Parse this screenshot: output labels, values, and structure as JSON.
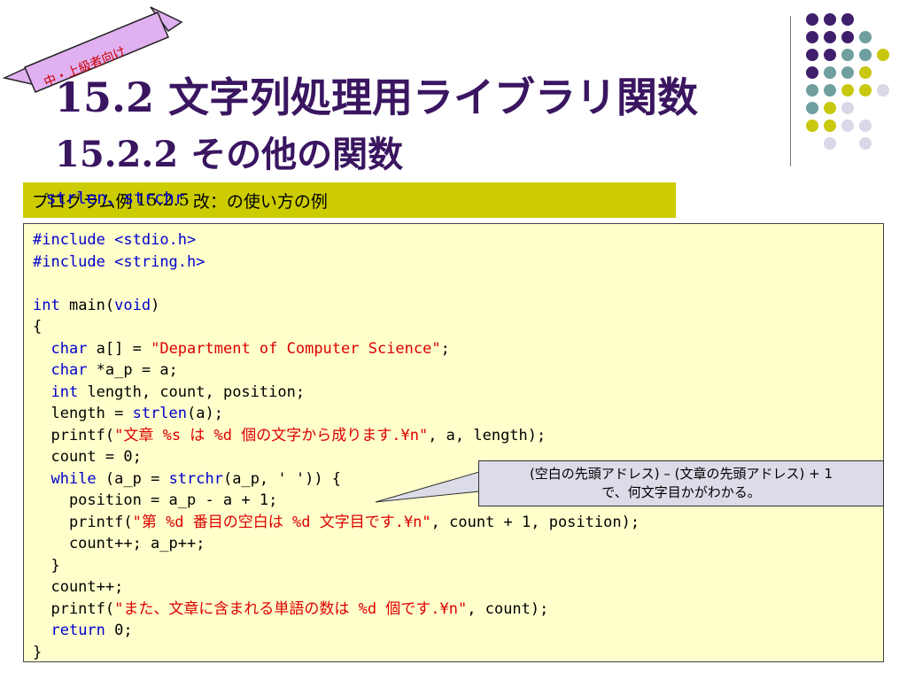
{
  "ribbon_label": "中・上級者向け",
  "title": "15.2 文字列処理用ライブラリ関数",
  "subtitle": "15.2.2 その他の関数",
  "caption": {
    "prefix": "プログラム例",
    "number": "15.2.5",
    "suffix": "改：",
    "functions": "strlen、strchr",
    "tail": "の使い方の例"
  },
  "code_lines": [
    "#include <stdio.h>",
    "#include <string.h>",
    "",
    "int main(void)",
    "{",
    "  char a[] = \"Department of Computer Science\";",
    "  char *a_p = a;",
    "  int length, count, position;",
    "  length = strlen(a);",
    "  printf(\"文章 %s は %d 個の文字から成ります.¥n\", a, length);",
    "  count = 0;",
    "  while (a_p = strchr(a_p, ' ')) {",
    "    position = a_p - a + 1;",
    "    printf(\"第 %d 番目の空白は %d 文字目です.¥n\", count + 1, position);",
    "    count++; a_p++;",
    "  }",
    "  count++;",
    "  printf(\"また、文章に含まれる単語の数は %d 個です.¥n\", count);",
    "  return 0;",
    "}"
  ],
  "callout": {
    "line1": "(空白の先頭アドレス) – (文章の先頭アドレス) + 1",
    "line2": "で、何文字目かがわかる。"
  },
  "colors": {
    "title": "#3a1560",
    "caption_bg": "#cccc00",
    "code_bg": "#ffffcc",
    "keyword": "#0000cc",
    "string": "#dd0000",
    "callout_bg": "#dcdce8",
    "ribbon_bg": "#e0b0f0",
    "dot_purple": "#3f1f6b",
    "dot_teal": "#6f9f9f",
    "dot_yellow": "#c8c810",
    "dot_lavender": "#d8d8e8"
  }
}
